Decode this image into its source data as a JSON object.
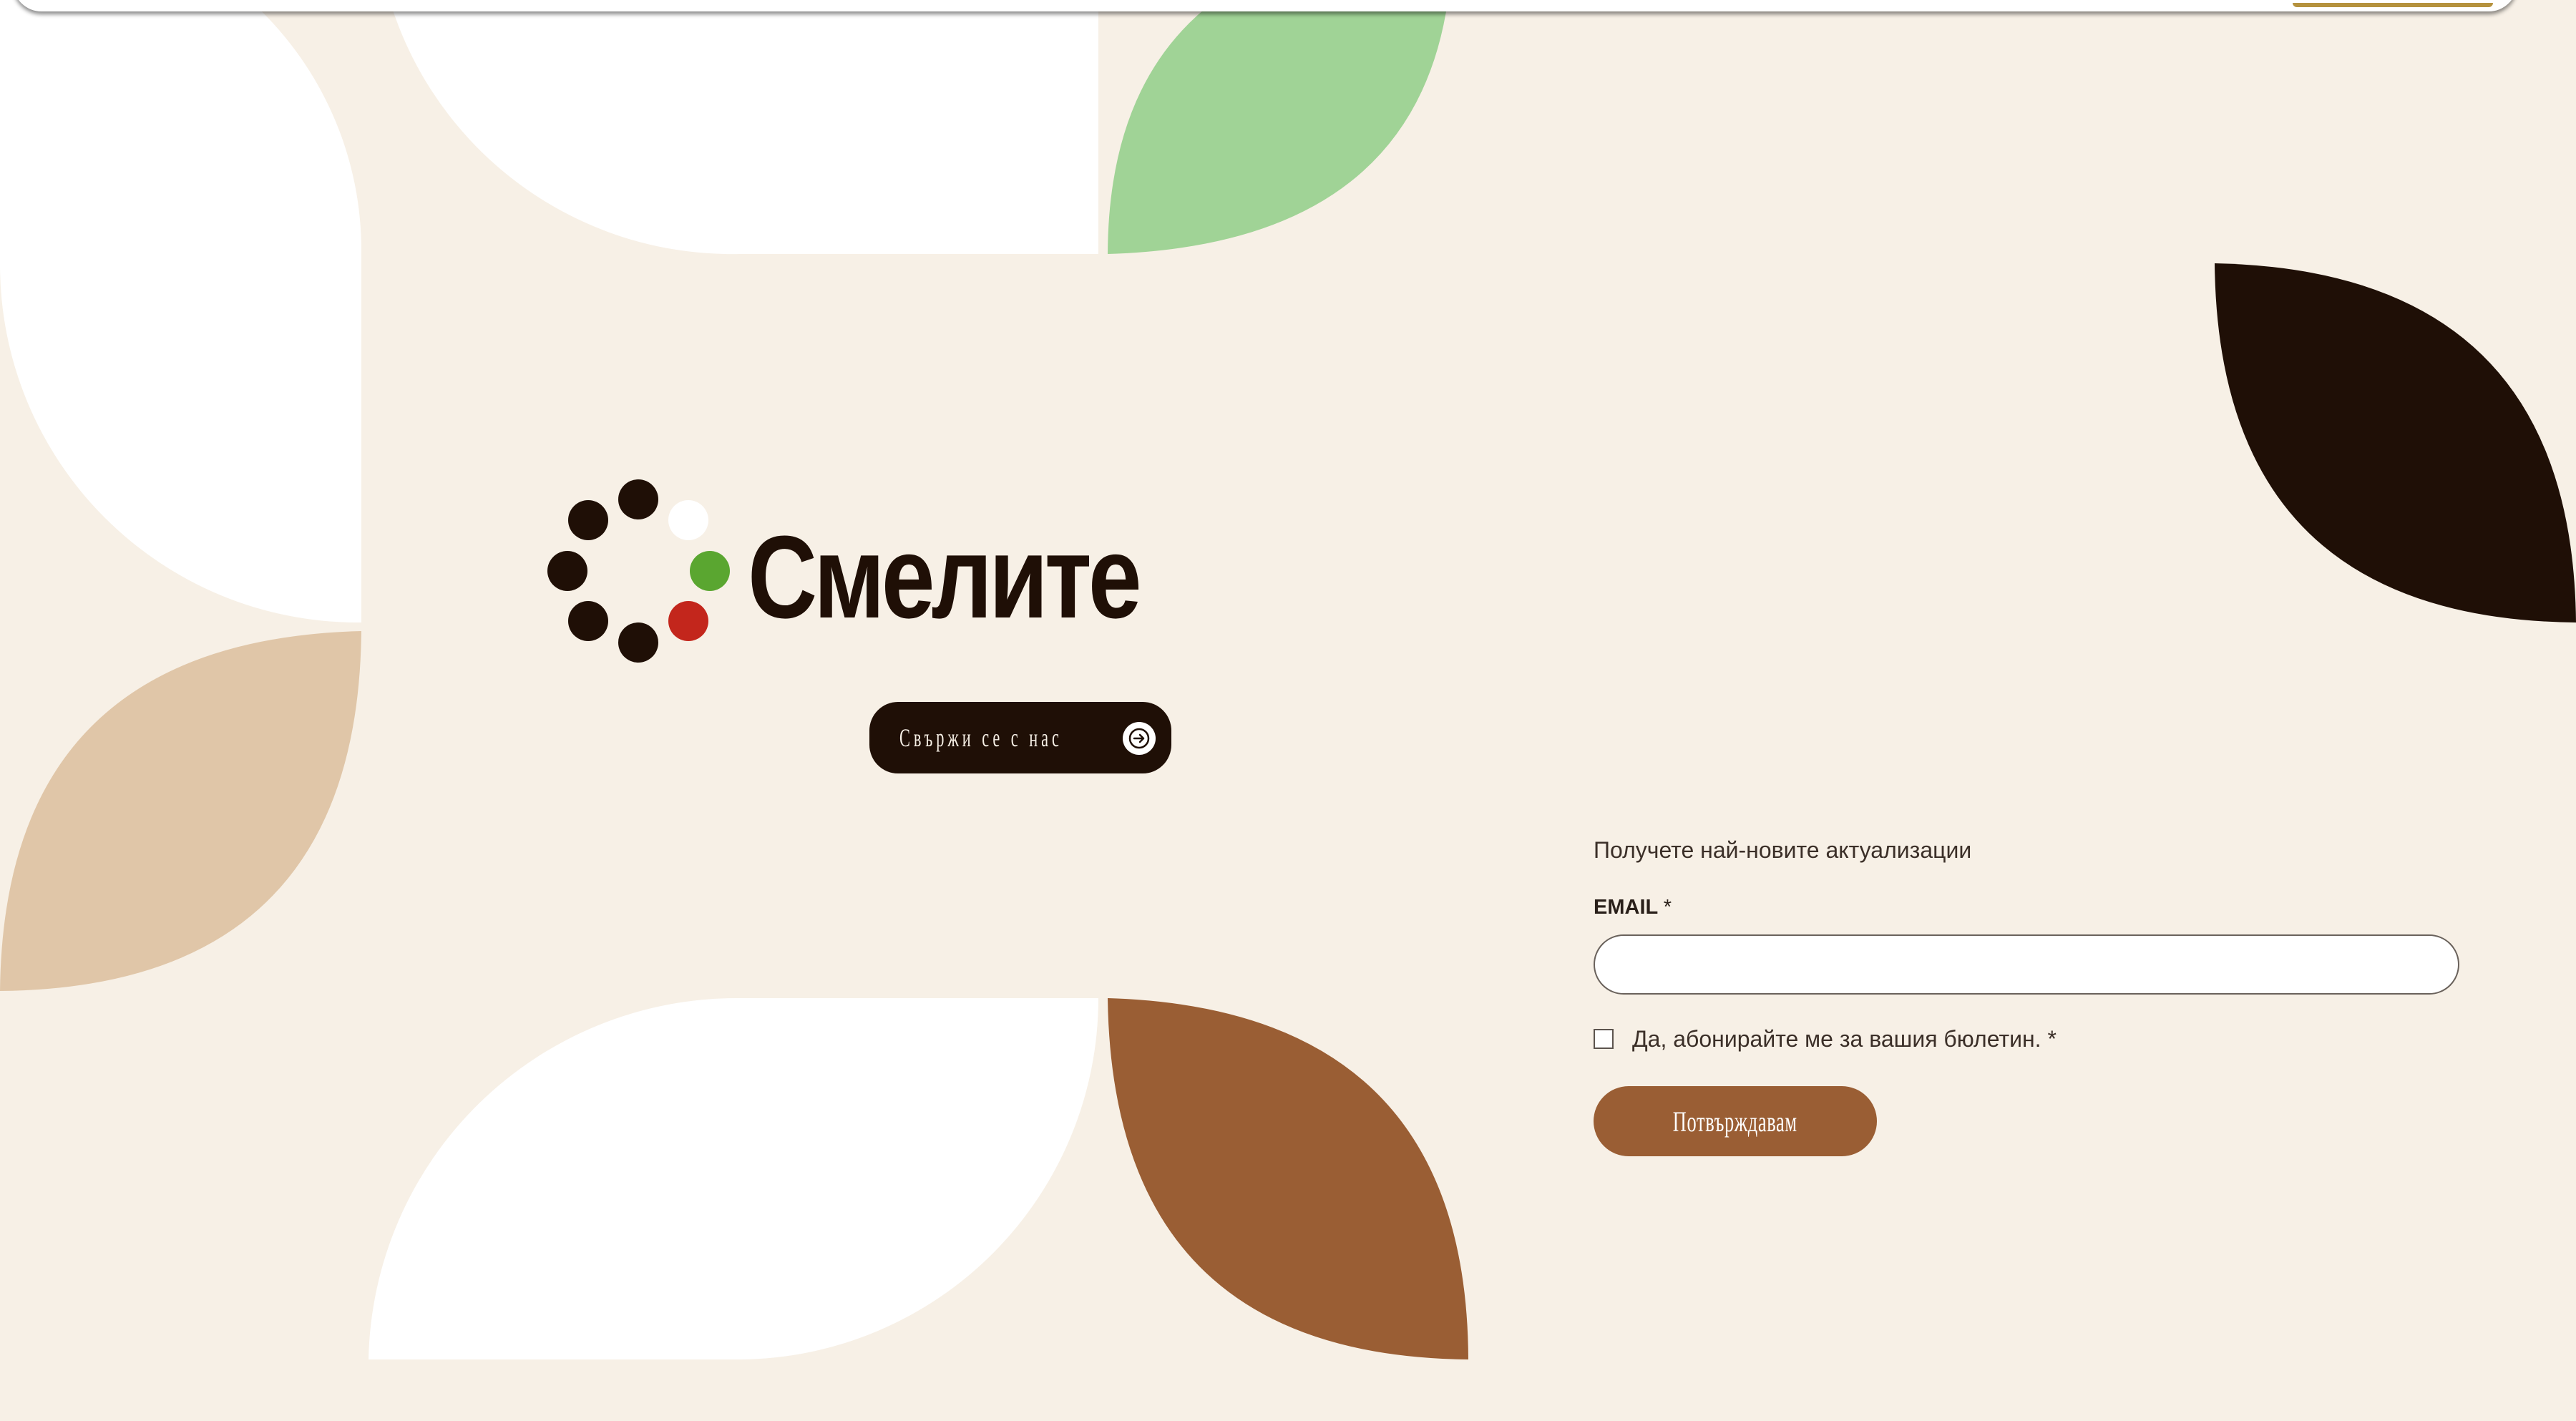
{
  "brand": {
    "name": "Смелите",
    "dot_colors": {
      "dark": "#1f0f06",
      "white": "#ffffff",
      "green": "#5aa630",
      "red": "#c3261c"
    }
  },
  "colors": {
    "background": "#f7f0e6",
    "dark_brown": "#1f0f06",
    "brown": "#9a5e34",
    "tan": "#e0c6a8",
    "light_green": "#a0d396",
    "white": "#ffffff",
    "gold_accent": "#b5923e"
  },
  "contact": {
    "label": "Свържи се с нас",
    "icon": "arrow-right-icon"
  },
  "newsletter": {
    "heading": "Получете най-новите актуализации",
    "email_label": "EMAIL",
    "required_mark": "*",
    "email_value": "",
    "consent_text": "Да, абонирайте ме за вашия бюлетин.",
    "consent_checked": false,
    "submit_label": "Потвърждавам"
  }
}
